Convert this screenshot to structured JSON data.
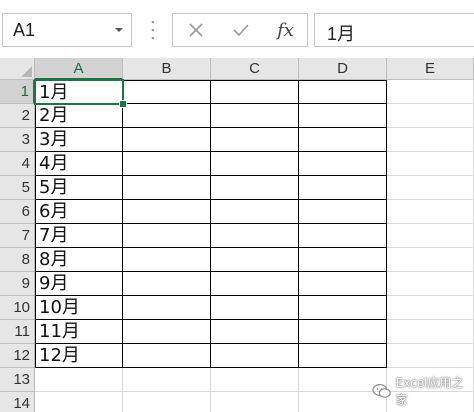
{
  "formula_bar": {
    "name_box_value": "A1",
    "cancel_icon": "close-icon",
    "enter_icon": "check-icon",
    "function_label": "fx",
    "formula_value": "1月"
  },
  "grid": {
    "columns": [
      "A",
      "B",
      "C",
      "D",
      "E"
    ],
    "rows": [
      "1",
      "2",
      "3",
      "4",
      "5",
      "6",
      "7",
      "8",
      "9",
      "10",
      "11",
      "12",
      "13",
      "14"
    ],
    "column_a_values": [
      "1月",
      "2月",
      "3月",
      "4月",
      "5月",
      "6月",
      "7月",
      "8月",
      "9月",
      "10月",
      "11月",
      "12月",
      "",
      ""
    ],
    "active_cell": "A1",
    "active_column": "A",
    "active_row": "1"
  },
  "colors": {
    "accent": "#217346",
    "header_bg": "#e6e6e6",
    "gridline": "#dadada",
    "table_border": "#000000"
  },
  "watermark": {
    "text": "Excel应用之家",
    "icon": "wechat-icon"
  }
}
